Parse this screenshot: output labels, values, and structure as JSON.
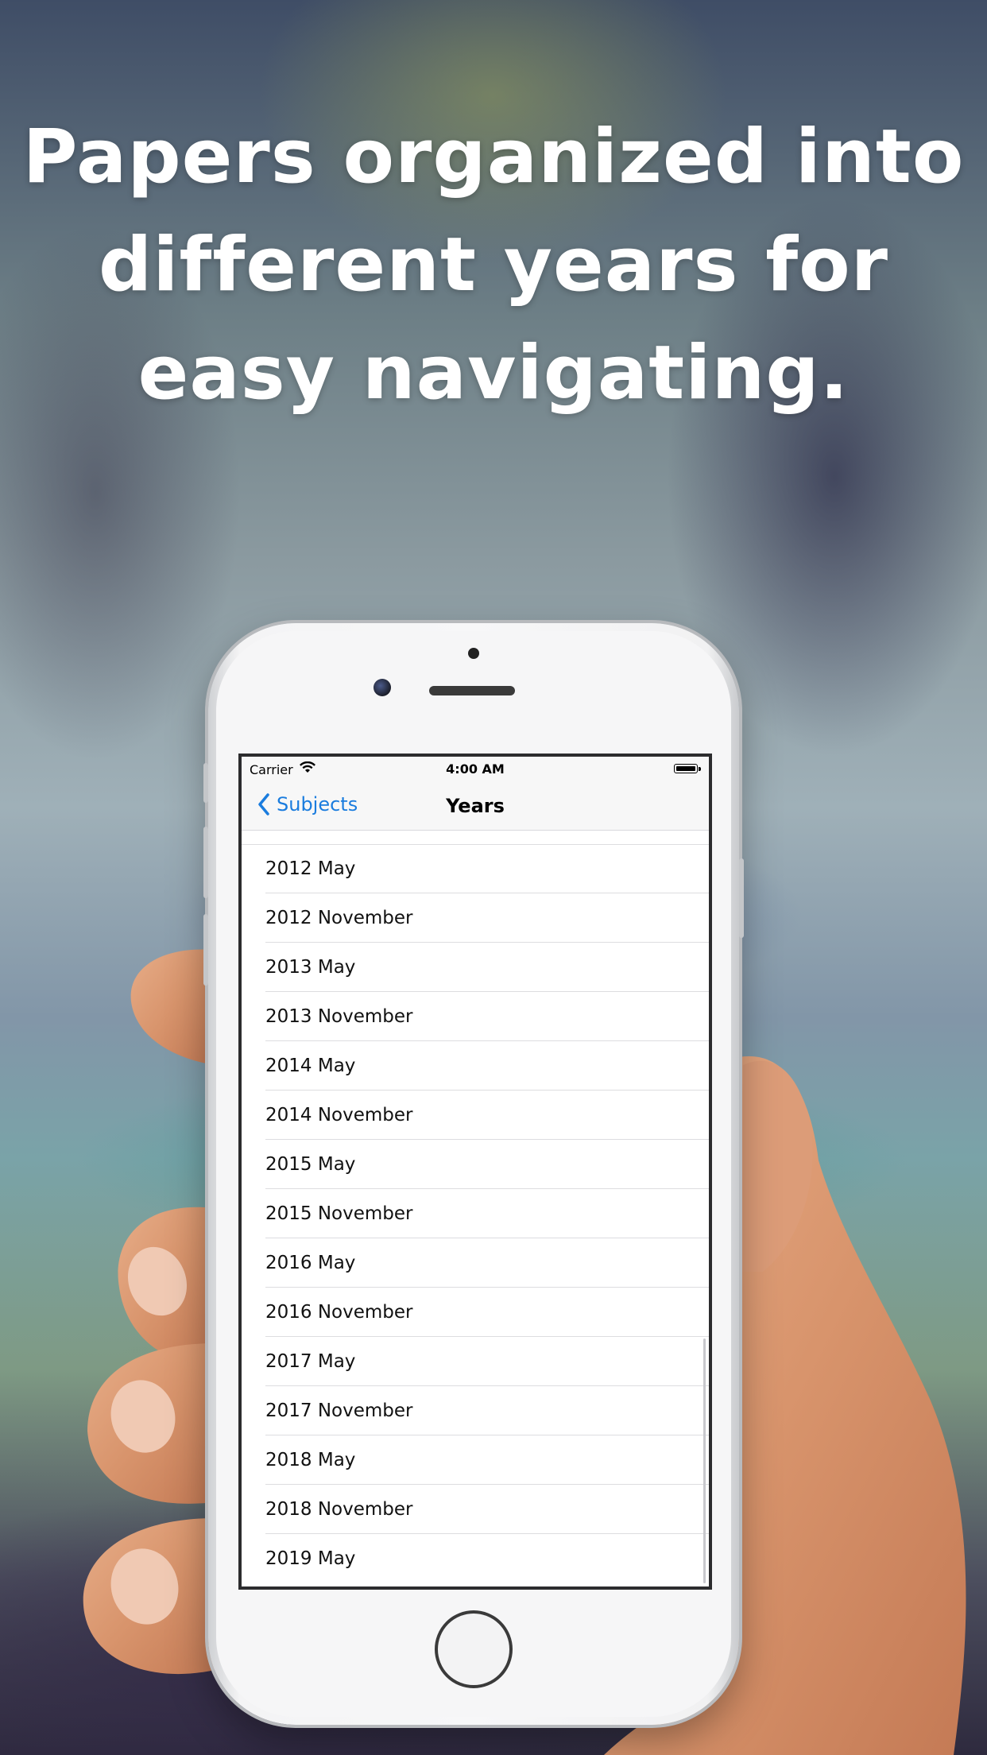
{
  "headline": {
    "lines": [
      "Papers organized into",
      "different years for",
      "easy navigating."
    ]
  },
  "status_bar": {
    "carrier": "Carrier",
    "time": "4:00 AM"
  },
  "nav_bar": {
    "back_label": "Subjects",
    "title": "Years"
  },
  "years": [
    "2012 May",
    "2012 November",
    "2013 May",
    "2013 November",
    "2014 May",
    "2014 November",
    "2015 May",
    "2015 November",
    "2016 May",
    "2016 November",
    "2017 May",
    "2017 November",
    "2018 May",
    "2018 November",
    "2019 May"
  ],
  "colors": {
    "accent": "#1a7cde",
    "headline_text": "#ffffff"
  }
}
